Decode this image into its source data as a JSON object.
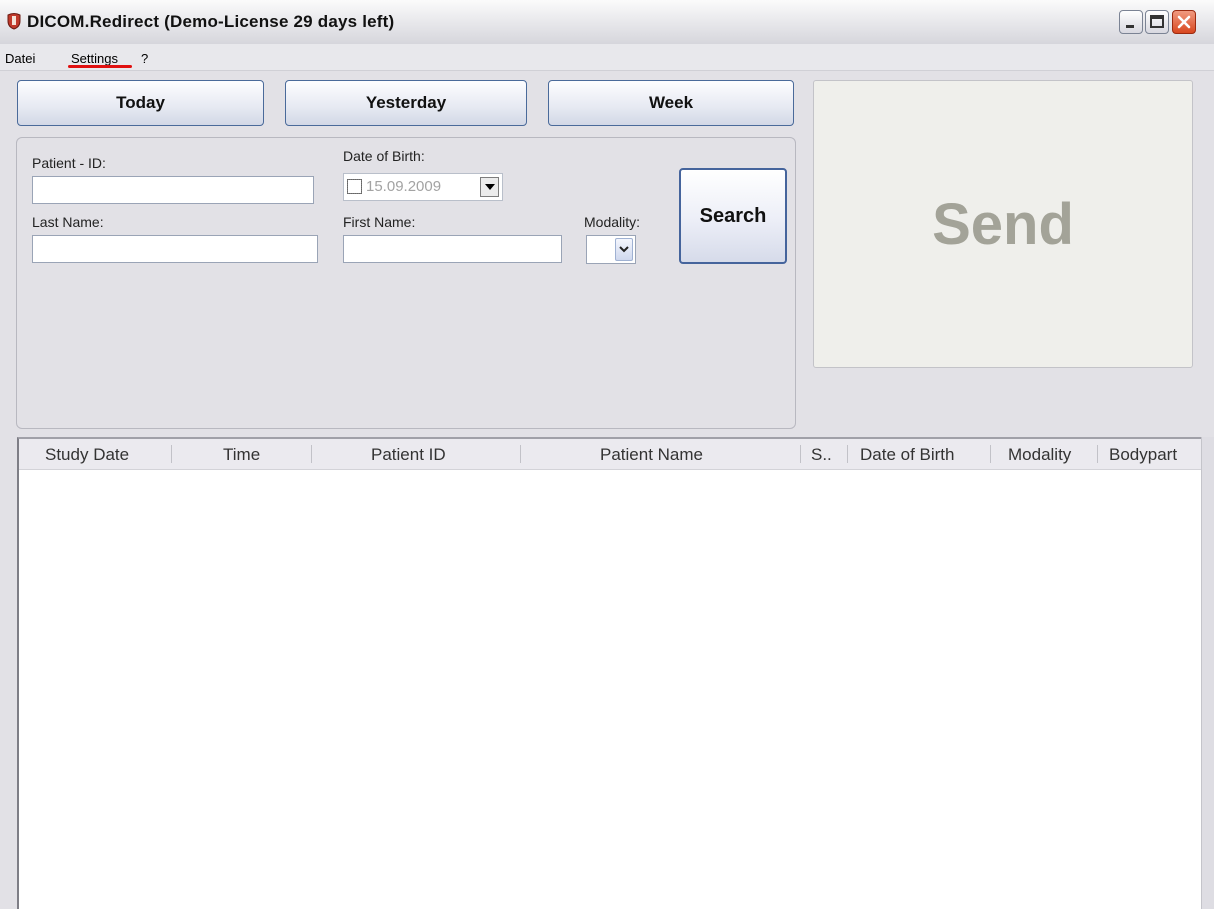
{
  "window": {
    "title": "DICOM.Redirect (Demo-License 29 days left)"
  },
  "menu": {
    "items": [
      "Datei",
      "Settings",
      "?"
    ]
  },
  "quick_buttons": {
    "today": "Today",
    "yesterday": "Yesterday",
    "week": "Week"
  },
  "search": {
    "patient_id_label": "Patient - ID:",
    "patient_id_value": "",
    "dob_label": "Date of Birth:",
    "dob_value": "15.09.2009",
    "dob_checked": false,
    "last_name_label": "Last Name:",
    "last_name_value": "",
    "first_name_label": "First Name:",
    "first_name_value": "",
    "modality_label": "Modality:",
    "modality_value": "",
    "search_button": "Search"
  },
  "send": {
    "label": "Send"
  },
  "table": {
    "columns": [
      "Study Date",
      "Time",
      "Patient ID",
      "Patient Name",
      "S..",
      "Date of Birth",
      "Modality",
      "Bodypart"
    ],
    "rows": []
  },
  "colors": {
    "accent_border": "#45649c",
    "send_text": "#a3a398",
    "menu_highlight": "#e01010"
  }
}
